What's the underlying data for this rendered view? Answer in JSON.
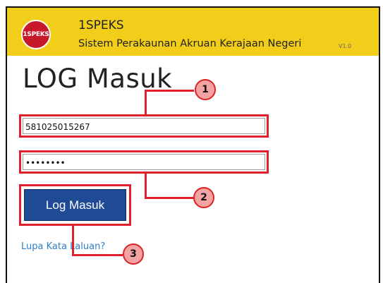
{
  "header": {
    "logo_text": "1SPEKS",
    "app_name": "1SPEKS",
    "app_subtitle": "Sistem Perakaunan Akruan Kerajaan Negeri",
    "version": "V1.0"
  },
  "page": {
    "title": "LOG Masuk"
  },
  "form": {
    "username_value": "581025015267",
    "password_value": "••••••••",
    "submit_label": "Log Masuk",
    "forgot_link": "Lupa Kata Laluan?"
  },
  "callouts": [
    "1",
    "2",
    "3"
  ],
  "colors": {
    "header_bg": "#f2cd1a",
    "logo_red": "#c8192a",
    "button_blue": "#1e4a96",
    "highlight_red": "#e0202c",
    "link_blue": "#2c7fc9"
  }
}
